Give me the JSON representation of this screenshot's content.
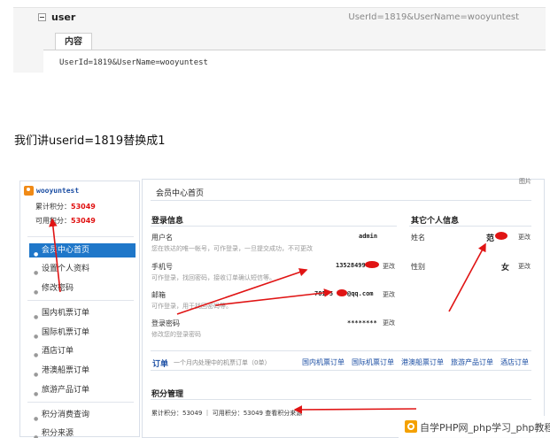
{
  "cookie_panel": {
    "name": "user",
    "summary": "UserId=1819&UserName=wooyuntest",
    "tab_label": "内容",
    "value": "UserId=1819&UserName=wooyuntest"
  },
  "instruction": "我们讲userid=1819替换成1",
  "member": {
    "corner_label": "图片",
    "sidebar": {
      "username": "wooyuntest",
      "total_points_label": "累计积分：",
      "total_points": "53049",
      "available_points_label": "可用积分：",
      "available_points": "53049",
      "nav": [
        {
          "label": "会员中心首页",
          "active": true
        },
        {
          "label": "设置个人资料",
          "active": false
        },
        {
          "label": "修改密码",
          "active": false
        },
        {
          "label": "国内机票订单",
          "active": false
        },
        {
          "label": "国际机票订单",
          "active": false
        },
        {
          "label": "酒店订单",
          "active": false
        },
        {
          "label": "港澳船票订单",
          "active": false
        },
        {
          "label": "旅游产品订单",
          "active": false
        },
        {
          "label": "积分消费查询",
          "active": false
        },
        {
          "label": "积分来源",
          "active": false
        }
      ]
    },
    "page_title": "会员中心首页",
    "login_info": {
      "title": "登录信息",
      "username": {
        "label": "用户名",
        "value": "admin",
        "desc": "您在铁达的唯一帐号，可作登录，一旦提交成功，不可更改"
      },
      "phone": {
        "label": "手机号",
        "value": "13528499",
        "desc": "可作登录，找回密码，接收订单确认短信等。",
        "change": "更改"
      },
      "email": {
        "label": "邮箱",
        "value_prefix": "78175",
        "value_suffix": "@qq.com",
        "desc": "可作登录，用于找回密码等。",
        "change": "更改"
      },
      "password": {
        "label": "登录密码",
        "value": "********",
        "desc": "修改您的登录密码",
        "change": "更改"
      }
    },
    "other_info": {
      "title": "其它个人信息",
      "name": {
        "label": "姓名",
        "value": "范",
        "change": "更改"
      },
      "gender": {
        "label": "性别",
        "value": "女",
        "change": "更改"
      }
    },
    "orders": {
      "label": "订单",
      "desc": "一个月内处理中的机票订单（0单）",
      "links": [
        "国内机票订单",
        "国际机票订单",
        "港澳船票订单",
        "旅游产品订单",
        "酒店订单"
      ]
    },
    "points": {
      "title": "积分管理",
      "summary": "累计积分：53049 ｜ 可用积分：53049  查看积分来源"
    }
  },
  "watermark": {
    "text": "自学PHP网_php学习_php教程"
  },
  "colors": {
    "accent_blue": "#1f77c9",
    "link_blue": "#1b4ea3",
    "annotation_red": "#e01414",
    "brand_orange": "#f08a16"
  }
}
